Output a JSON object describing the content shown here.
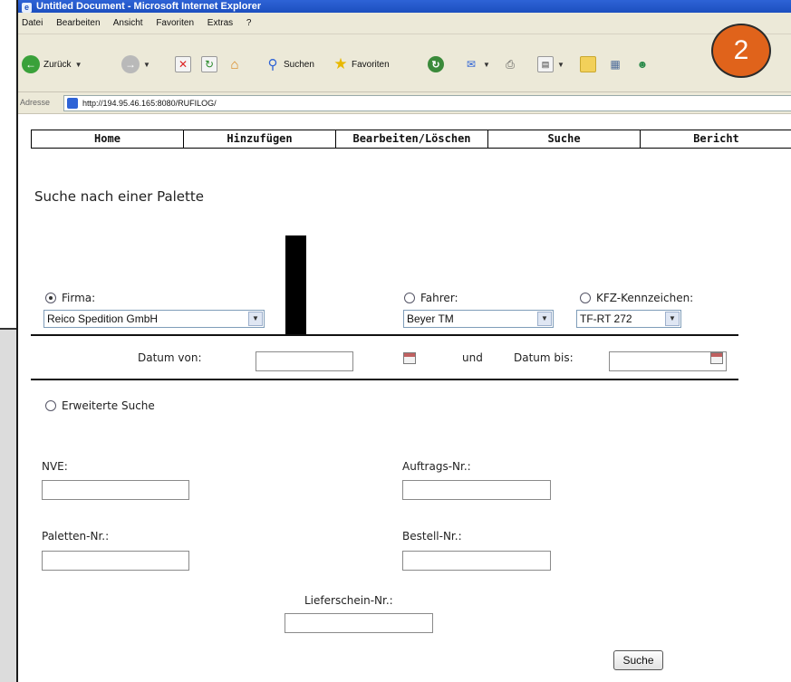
{
  "window": {
    "title": "Untitled Document - Microsoft Internet Explorer"
  },
  "menu": [
    "Datei",
    "Bearbeiten",
    "Ansicht",
    "Favoriten",
    "Extras",
    "?"
  ],
  "toolbar": {
    "back_label": "Zurück",
    "search_label": "Suchen",
    "favorites_label": "Favoriten"
  },
  "badge": "2",
  "address": {
    "label": "Adresse",
    "url": "http://194.95.46.165:8080/RUFILOG/"
  },
  "nav": [
    "Home",
    "Hinzufügen",
    "Bearbeiten/Löschen",
    "Suche",
    "Bericht"
  ],
  "page": {
    "title": "Suche nach einer Palette"
  },
  "filters": {
    "firma": {
      "label": "Firma:",
      "value": "Reico Spedition GmbH",
      "checked": true
    },
    "fahrer": {
      "label": "Fahrer:",
      "value": "Beyer TM",
      "checked": false
    },
    "kfz": {
      "label": "KFZ-Kennzeichen:",
      "value": "TF-RT 272",
      "checked": false
    }
  },
  "date": {
    "from_label": "Datum von:",
    "and_label": "und",
    "to_label": "Datum bis:"
  },
  "advanced": {
    "label": "Erweiterte Suche",
    "fields": {
      "nve": "NVE:",
      "auftrag": "Auftrags-Nr.:",
      "paletten": "Paletten-Nr.:",
      "bestell": "Bestell-Nr.:",
      "lieferschein": "Lieferschein-Nr.:"
    }
  },
  "submit_label": "Suche",
  "colors": {
    "titlebar": "#2e63d6",
    "chrome": "#ece9d8",
    "badge": "#e0631b"
  }
}
